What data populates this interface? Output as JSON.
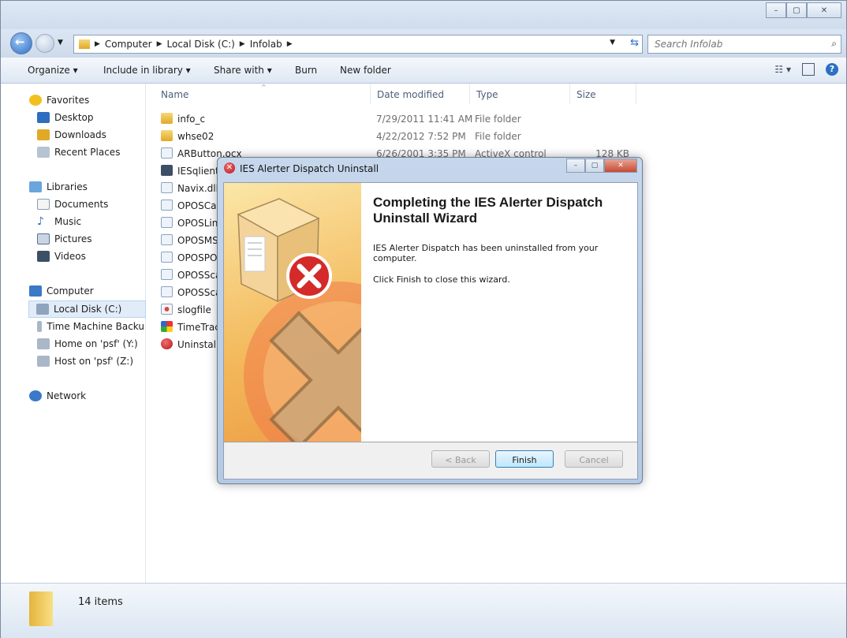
{
  "window": {
    "controls": {
      "minimize": "–",
      "maximize": "▢",
      "close": "✕"
    }
  },
  "address": {
    "crumbs": [
      "Computer",
      "Local Disk (C:)",
      "Infolab"
    ],
    "search_placeholder": "Search Infolab"
  },
  "toolbar": {
    "organize": "Organize ▾",
    "include_in_library": "Include in library ▾",
    "share_with": "Share with ▾",
    "burn": "Burn",
    "new_folder": "New folder"
  },
  "sidebar": {
    "items": [
      {
        "label": "Favorites",
        "icon": "star-icon"
      },
      {
        "label": "Desktop",
        "icon": "desktop-icon"
      },
      {
        "label": "Downloads",
        "icon": "downloads-icon"
      },
      {
        "label": "Recent Places",
        "icon": "recent-places-icon"
      },
      {
        "label": "Libraries",
        "icon": "library-icon"
      },
      {
        "label": "Documents",
        "icon": "documents-icon"
      },
      {
        "label": "Music",
        "icon": "music-icon"
      },
      {
        "label": "Pictures",
        "icon": "pictures-icon"
      },
      {
        "label": "Videos",
        "icon": "videos-icon"
      },
      {
        "label": "Computer",
        "icon": "computer-icon"
      },
      {
        "label": "Local Disk (C:)",
        "icon": "drive-icon"
      },
      {
        "label": "Time Machine Backu",
        "icon": "network-drive-icon"
      },
      {
        "label": "Home on 'psf' (Y:)",
        "icon": "network-drive-icon"
      },
      {
        "label": "Host on 'psf' (Z:)",
        "icon": "network-drive-icon"
      },
      {
        "label": "Network",
        "icon": "network-icon"
      }
    ]
  },
  "columns": {
    "name": "Name",
    "date": "Date modified",
    "type": "Type",
    "size": "Size"
  },
  "files": [
    {
      "name": "info_c",
      "date": "7/29/2011 11:41 AM",
      "type": "File folder",
      "size": ""
    },
    {
      "name": "whse02",
      "date": "4/22/2012 7:52 PM",
      "type": "File folder",
      "size": ""
    },
    {
      "name": "ARButton.ocx",
      "date": "6/26/2001 3:35 PM",
      "type": "ActiveX control",
      "size": "128 KB"
    },
    {
      "name": "IESqlient",
      "date": "",
      "type": "",
      "size": ""
    },
    {
      "name": "Navix.dll",
      "date": "",
      "type": "",
      "size": ""
    },
    {
      "name": "OPOSCas",
      "date": "",
      "type": "",
      "size": ""
    },
    {
      "name": "OPOSLin",
      "date": "",
      "type": "",
      "size": ""
    },
    {
      "name": "OPOSMS",
      "date": "",
      "type": "",
      "size": ""
    },
    {
      "name": "OPOSPO",
      "date": "",
      "type": "",
      "size": ""
    },
    {
      "name": "OPOSSca",
      "date": "",
      "type": "",
      "size": ""
    },
    {
      "name": "OPOSSca",
      "date": "",
      "type": "",
      "size": ""
    },
    {
      "name": "slogfile",
      "date": "",
      "type": "",
      "size": ""
    },
    {
      "name": "TimeTrac",
      "date": "",
      "type": "",
      "size": ""
    },
    {
      "name": "Uninstall",
      "date": "",
      "type": "",
      "size": ""
    }
  ],
  "status": {
    "count": "14 items"
  },
  "dialog": {
    "title": "IES Alerter Dispatch Uninstall",
    "heading": "Completing the IES Alerter Dispatch Uninstall Wizard",
    "message": "IES Alerter Dispatch has been uninstalled from your computer.",
    "instruction": "Click Finish to close this wizard.",
    "back_label": "< Back",
    "finish_label": "Finish",
    "cancel_label": "Cancel"
  },
  "colors": {
    "selection": "#e1ecf8",
    "accent": "#3c7fb1",
    "wizard_art": "#f3b85a",
    "error_red": "#c8202a"
  }
}
